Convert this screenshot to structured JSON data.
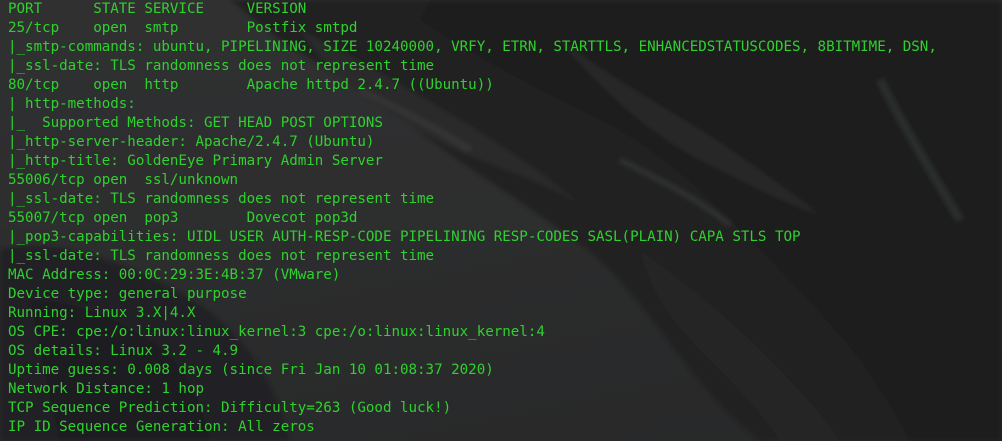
{
  "terminal": {
    "lines": [
      "PORT      STATE SERVICE     VERSION",
      "25/tcp    open  smtp        Postfix smtpd",
      "|_smtp-commands: ubuntu, PIPELINING, SIZE 10240000, VRFY, ETRN, STARTTLS, ENHANCEDSTATUSCODES, 8BITMIME, DSN,",
      "|_ssl-date: TLS randomness does not represent time",
      "80/tcp    open  http        Apache httpd 2.4.7 ((Ubuntu))",
      "| http-methods:",
      "|_  Supported Methods: GET HEAD POST OPTIONS",
      "|_http-server-header: Apache/2.4.7 (Ubuntu)",
      "|_http-title: GoldenEye Primary Admin Server",
      "55006/tcp open  ssl/unknown",
      "|_ssl-date: TLS randomness does not represent time",
      "55007/tcp open  pop3        Dovecot pop3d",
      "|_pop3-capabilities: UIDL USER AUTH-RESP-CODE PIPELINING RESP-CODES SASL(PLAIN) CAPA STLS TOP",
      "|_ssl-date: TLS randomness does not represent time",
      "MAC Address: 00:0C:29:3E:4B:37 (VMware)",
      "Device type: general purpose",
      "Running: Linux 3.X|4.X",
      "OS CPE: cpe:/o:linux:linux_kernel:3 cpe:/o:linux:linux_kernel:4",
      "OS details: Linux 3.2 - 4.9",
      "Uptime guess: 0.008 days (since Fri Jan 10 01:08:37 2020)",
      "Network Distance: 1 hop",
      "TCP Sequence Prediction: Difficulty=263 (Good luck!)",
      "IP ID Sequence Generation: All zeros"
    ]
  },
  "colors": {
    "text": "#2fd12f",
    "background": "#2f3031"
  }
}
